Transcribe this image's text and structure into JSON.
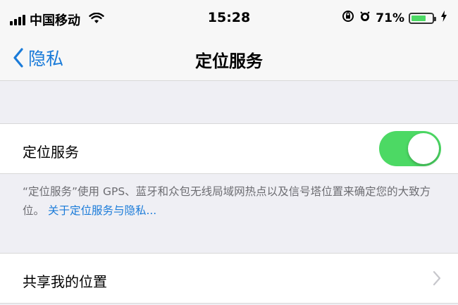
{
  "status_bar": {
    "carrier": "中国移动",
    "time": "15:28",
    "battery_percent": "71%",
    "battery_level": 0.71,
    "icons": [
      "signal-icon",
      "wifi-icon",
      "lock-rotation-icon",
      "alarm-icon",
      "battery-icon",
      "charging-icon"
    ]
  },
  "nav": {
    "back_label": "隐私",
    "title": "定位服务"
  },
  "location_services": {
    "label": "定位服务",
    "enabled": true,
    "toggle_color": "#4cd964"
  },
  "footnote": {
    "text": "“定位服务”使用 GPS、蓝牙和众包无线局域网热点以及信号塔位置来确定您的大致方位。",
    "link": "关于定位服务与隐私..."
  },
  "share_location": {
    "label": "共享我的位置"
  },
  "colors": {
    "accent": "#1a7bd9",
    "background_gray": "#efeff4",
    "toggle_on": "#4cd964"
  }
}
